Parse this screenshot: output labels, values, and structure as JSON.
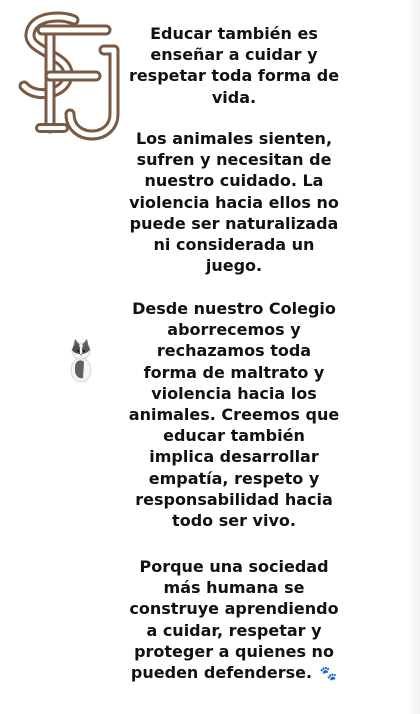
{
  "paragraphs": [
    "Educar también es enseñar a cuidar y respetar toda forma de vida.",
    "Los animales sienten, sufren y necesitan de nuestro cuidado. La violencia hacia ellos no puede ser naturalizada ni considerada un juego.",
    "Desde nuestro Colegio aborrecemos y rechazamos toda forma de maltrato y violencia hacia los animales. Creemos que educar también implica desarrollar empatía, respeto y responsabilidad hacia todo ser vivo.",
    "Porque una sociedad más humana se construye aprendiendo a cuidar, respetar y proteger a quienes no pueden defenderse."
  ],
  "paw_emoji": "🐾",
  "logo_letters": "SFJ",
  "colors": {
    "logo": "#7a5a43",
    "text": "#111111",
    "background": "#ffffff"
  },
  "icons": {
    "logo": "school-monogram-logo",
    "sticker": "cat-sticker",
    "emoji": "paw-prints-emoji"
  }
}
